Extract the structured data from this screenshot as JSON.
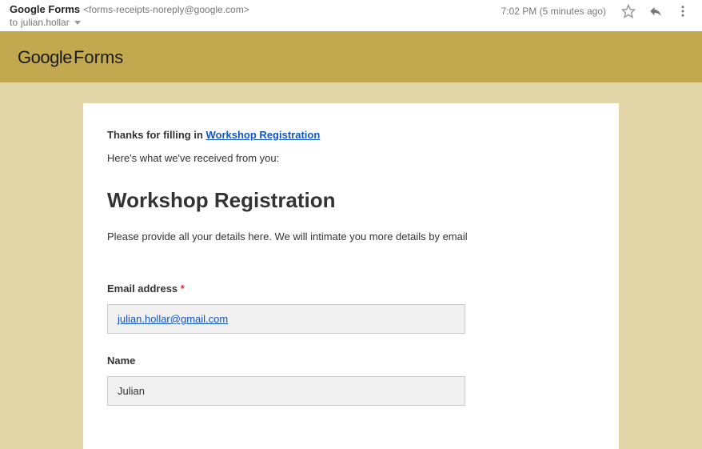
{
  "header": {
    "sender_name": "Google Forms",
    "sender_email": "<forms-receipts-noreply@google.com>",
    "recipient_prefix": "to",
    "recipient": "julian.hollar",
    "timestamp": "7:02 PM (5 minutes ago)"
  },
  "banner": {
    "logo_part1": "Google",
    "logo_part2": "Forms"
  },
  "content": {
    "thanks_prefix": "Thanks for filling in ",
    "thanks_link": "Workshop Registration",
    "received_text": "Here's what we've received from you:",
    "form_title": "Workshop Registration",
    "form_desc": "Please provide all your details here. We will intimate you more details by email",
    "fields": {
      "email": {
        "label": "Email address ",
        "required": "*",
        "value": "julian.hollar@gmail.com"
      },
      "name": {
        "label": "Name",
        "value": "Julian"
      }
    }
  }
}
